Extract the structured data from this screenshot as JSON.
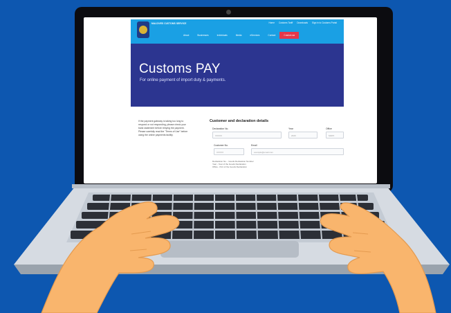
{
  "site": {
    "brand": "MALDIVES CUSTOMS SERVICE",
    "top_links": [
      "Home",
      "Customs Tariff",
      "Downloads",
      "Sign in to Customs Portal"
    ],
    "nav": [
      "About",
      "Businesses",
      "Individuals",
      "Media",
      "eServices",
      "Contact"
    ],
    "nav_emphasis": "Custom sw"
  },
  "hero": {
    "title": "Customs PAY",
    "subtitle": "For online payment of import duty & payments."
  },
  "side_note": "If the payment gateway is taking too long to respond or not responding, please check your bank statement before retrying the payment. Please carefully read the \"Terms of Use\" before using the online payments facility.",
  "form": {
    "title": "Customer and declaration details",
    "labels": {
      "declaration_no": "Declaration No.",
      "year": "Year",
      "office": "Office",
      "customer_no": "Customer No.",
      "email": "Email"
    },
    "placeholders": {
      "declaration_no": "XXXXX",
      "year": "2020",
      "office": "MAPF",
      "customer_no": "CXXXX",
      "email": "example@email.com"
    },
    "hints": [
      "Declaration No. - Goods Declaration Number",
      "Year - Year of the Goods Declaration",
      "Office - Port of the Goods Declaration"
    ]
  },
  "colors": {
    "background": "#0d57b0",
    "topbar": "#1aa0e4",
    "hero": "#2c3590",
    "nav_emphasis": "#e5374a",
    "skin": "#f9b56d"
  }
}
